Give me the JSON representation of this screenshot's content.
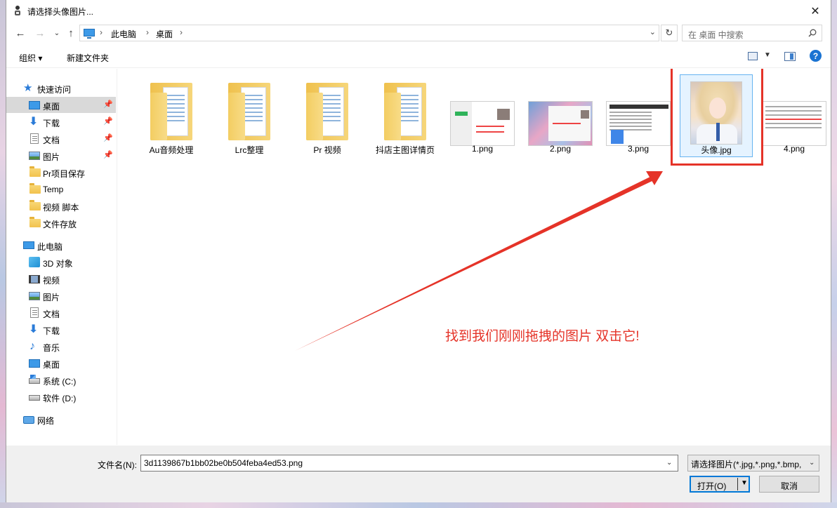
{
  "window": {
    "title": "请选择头像图片..."
  },
  "address": {
    "breadcrumbs": [
      "此电脑",
      "桌面"
    ],
    "search_placeholder": "在 桌面 中搜索"
  },
  "toolbar": {
    "organize": "组织 ▾",
    "new_folder": "新建文件夹"
  },
  "nav": {
    "quick_access": "快速访问",
    "quick_items": [
      {
        "label": "桌面",
        "icon": "desktop-icon",
        "pinned": true,
        "selected": true
      },
      {
        "label": "下载",
        "icon": "download-icon",
        "pinned": true
      },
      {
        "label": "文档",
        "icon": "document-icon",
        "pinned": true
      },
      {
        "label": "图片",
        "icon": "pictures-icon",
        "pinned": true
      },
      {
        "label": "Pr项目保存",
        "icon": "folder-icon"
      },
      {
        "label": "Temp",
        "icon": "folder-icon"
      },
      {
        "label": "视频 脚本",
        "icon": "folder-icon"
      },
      {
        "label": "文件存放",
        "icon": "folder-icon"
      }
    ],
    "this_pc": "此电脑",
    "pc_items": [
      {
        "label": "3D 对象",
        "icon": "3d-objects-icon"
      },
      {
        "label": "视频",
        "icon": "videos-icon"
      },
      {
        "label": "图片",
        "icon": "pictures-icon"
      },
      {
        "label": "文档",
        "icon": "document-icon"
      },
      {
        "label": "下载",
        "icon": "download-icon"
      },
      {
        "label": "音乐",
        "icon": "music-icon"
      },
      {
        "label": "桌面",
        "icon": "desktop-icon"
      },
      {
        "label": "系统 (C:)",
        "icon": "system-drive-icon"
      },
      {
        "label": "软件 (D:)",
        "icon": "drive-icon"
      }
    ],
    "network": "网络"
  },
  "files": [
    {
      "name": "Au音频处理",
      "type": "folder"
    },
    {
      "name": "Lrc整理",
      "type": "folder"
    },
    {
      "name": "Pr 视频",
      "type": "folder"
    },
    {
      "name": "抖店主图详情页",
      "type": "folder"
    },
    {
      "name": "1.png",
      "type": "image"
    },
    {
      "name": "2.png",
      "type": "image"
    },
    {
      "name": "3.png",
      "type": "image"
    },
    {
      "name": "头像.jpg",
      "type": "image",
      "selected": true
    },
    {
      "name": "4.png",
      "type": "image"
    }
  ],
  "annotation": {
    "text": "找到我们刚刚拖拽的图片 双击它!",
    "color": "#e53328"
  },
  "bottom": {
    "filename_label": "文件名(N):",
    "filename_value": "3d1139867b1bb02be0b504feba4ed53.png",
    "filter": "请选择图片(*.jpg,*.png,*.bmp,",
    "open_label": "打开(O)",
    "cancel_label": "取消"
  },
  "colors": {
    "accent": "#0078d7",
    "selection": "#cce8ff",
    "annotation": "#e53328"
  }
}
